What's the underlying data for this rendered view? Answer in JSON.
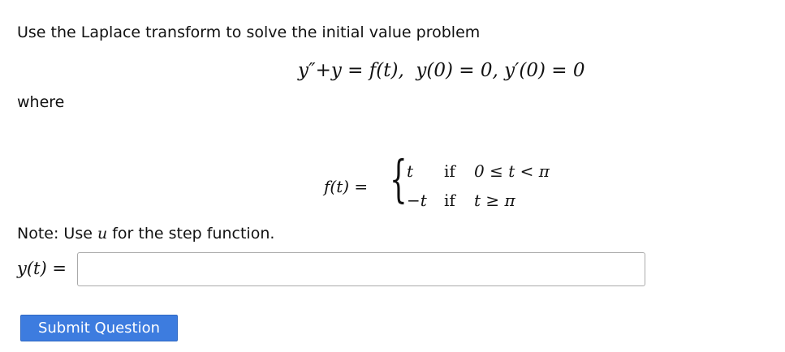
{
  "question": {
    "prompt": "Use the Laplace transform to solve the initial value problem",
    "ode": {
      "lhs": "y″+y",
      "equals": " = ",
      "rhs": "f(t),",
      "ic": "y(0) = 0, y′(0) = 0"
    },
    "where_label": "where",
    "piecewise": {
      "lhs": "f(t) =",
      "brace": "{",
      "rows": [
        {
          "expr": "t",
          "if": "if",
          "cond": "0 ≤ t < π"
        },
        {
          "expr": "−t",
          "if": "if",
          "cond": "t ≥ π"
        }
      ]
    },
    "note_prefix": "Note: Use ",
    "note_var": "u",
    "note_suffix": " for the step function.",
    "answer_label": "y(t) ="
  },
  "answer": {
    "value": "",
    "placeholder": ""
  },
  "submit_label": "Submit Question"
}
